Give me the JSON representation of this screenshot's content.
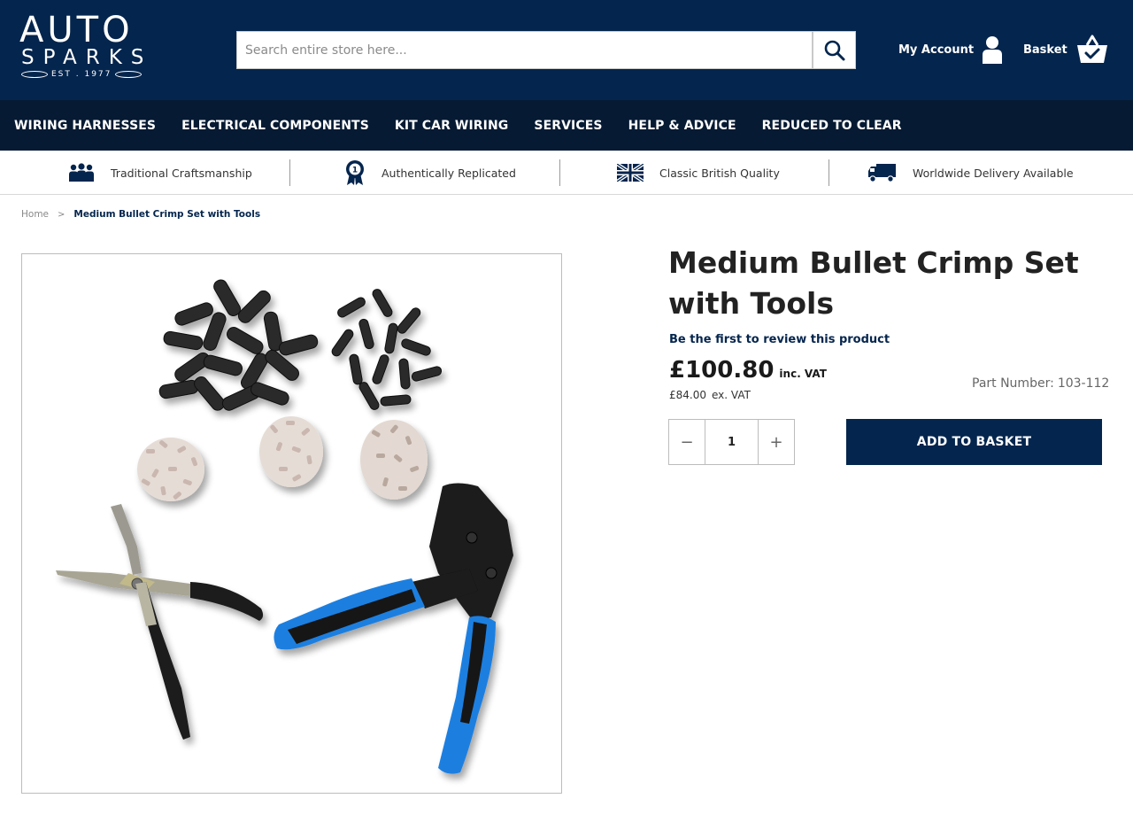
{
  "brand": {
    "line1": "AUTO",
    "line2": "SPARKS",
    "line3": "EST . 1977"
  },
  "search": {
    "placeholder": "Search entire store here..."
  },
  "header": {
    "account_label": "My Account",
    "basket_label": "Basket"
  },
  "nav": {
    "items": [
      {
        "label": "WIRING HARNESSES"
      },
      {
        "label": "ELECTRICAL COMPONENTS"
      },
      {
        "label": "KIT CAR WIRING"
      },
      {
        "label": "SERVICES"
      },
      {
        "label": "HELP & ADVICE"
      },
      {
        "label": "REDUCED TO CLEAR"
      }
    ]
  },
  "usp": {
    "items": [
      {
        "label": "Traditional Craftsmanship",
        "icon": "people-icon"
      },
      {
        "label": "Authentically Replicated",
        "icon": "rosette-icon"
      },
      {
        "label": "Classic British Quality",
        "icon": "union-flag-icon"
      },
      {
        "label": "Worldwide Delivery Available",
        "icon": "delivery-truck-icon"
      }
    ]
  },
  "breadcrumb": {
    "home": "Home",
    "separator": ">",
    "current": "Medium Bullet Crimp Set with Tools"
  },
  "product": {
    "title": "Medium Bullet Crimp Set with Tools",
    "review_link": "Be the first to review this product",
    "price_inc": "£100.80",
    "price_inc_suffix": "inc. VAT",
    "price_ex": "£84.00",
    "price_ex_suffix": "ex. VAT",
    "part_number_label": "Part Number:",
    "part_number": "103-112",
    "quantity": "1",
    "decrease_label": "−",
    "increase_label": "+",
    "add_to_basket_label": "ADD TO BASKET"
  },
  "colors": {
    "header_bg": "#04254d",
    "nav_bg": "#061a33",
    "button_bg": "#04254d",
    "tool_blue": "#1e7fe0"
  }
}
